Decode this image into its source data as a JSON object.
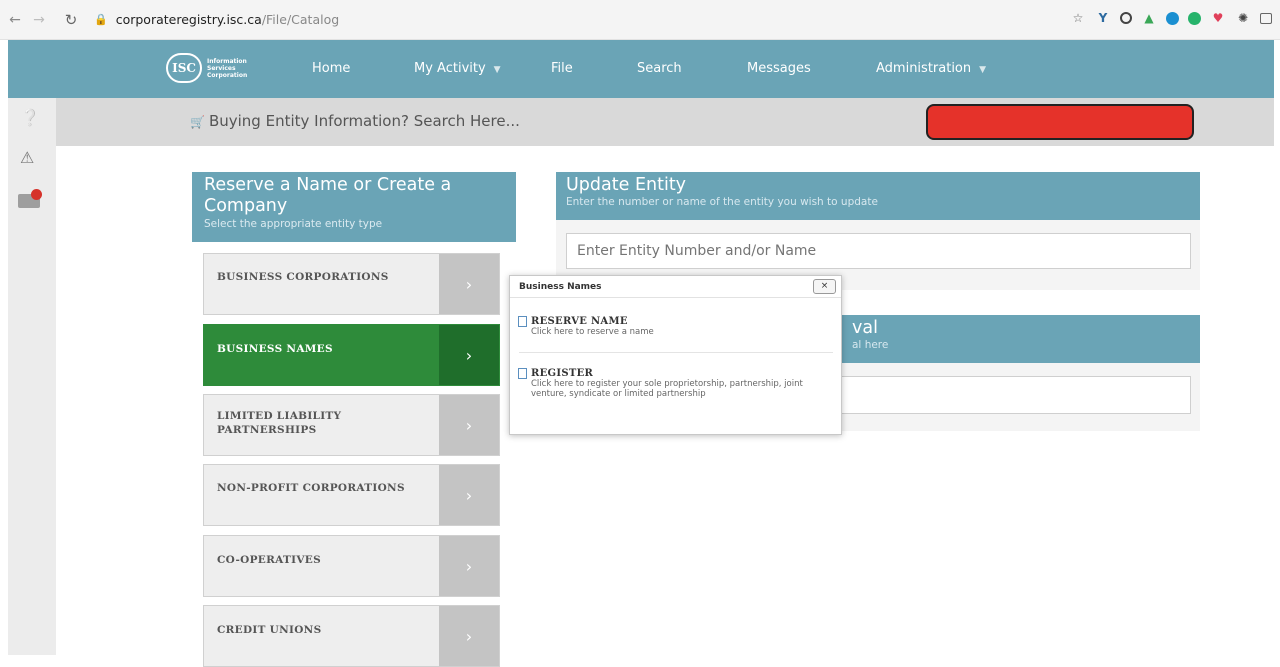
{
  "browser": {
    "url_host": "corporateregistry.isc.ca",
    "url_path": "/File/Catalog"
  },
  "site_nav": {
    "logo_text": "Information Services Corporation",
    "logo_mark": "ISC",
    "items": [
      {
        "label": "Home",
        "has_menu": false
      },
      {
        "label": "My Activity",
        "has_menu": true
      },
      {
        "label": "File",
        "has_menu": false
      },
      {
        "label": "Search",
        "has_menu": false
      },
      {
        "label": "Messages",
        "has_menu": false
      },
      {
        "label": "Administration",
        "has_menu": true
      }
    ]
  },
  "search_strip": {
    "text": "Buying Entity Information? Search Here..."
  },
  "reserve_panel": {
    "title": "Reserve a Name or Create a Company",
    "subtitle": "Select the appropriate entity type",
    "items": [
      {
        "label": "BUSINESS CORPORATIONS",
        "active": false
      },
      {
        "label": "BUSINESS NAMES",
        "active": true
      },
      {
        "label": "LIMITED LIABILITY PARTNERSHIPS",
        "active": false
      },
      {
        "label": "NON-PROFIT CORPORATIONS",
        "active": false
      },
      {
        "label": "CO-OPERATIVES",
        "active": false
      },
      {
        "label": "CREDIT UNIONS",
        "active": false
      }
    ]
  },
  "update_panel": {
    "title": "Update Entity",
    "subtitle": "Enter the number or name of the entity you wish to update",
    "input_placeholder": "Enter Entity Number and/or Name"
  },
  "second_panel": {
    "title_visible": "val",
    "subtitle_visible": "al here"
  },
  "popup": {
    "title": "Business Names",
    "close_label": "×",
    "items": [
      {
        "name": "RESERVE NAME",
        "desc": "Click here to reserve a name"
      },
      {
        "name": "REGISTER",
        "desc": "Click here to register your sole proprietorship, partnership, joint venture, syndicate or limited partnership"
      }
    ]
  },
  "colors": {
    "nav": "#6aa4b6",
    "active_green": "#2e8b3a",
    "redacted": "#e5322a"
  }
}
